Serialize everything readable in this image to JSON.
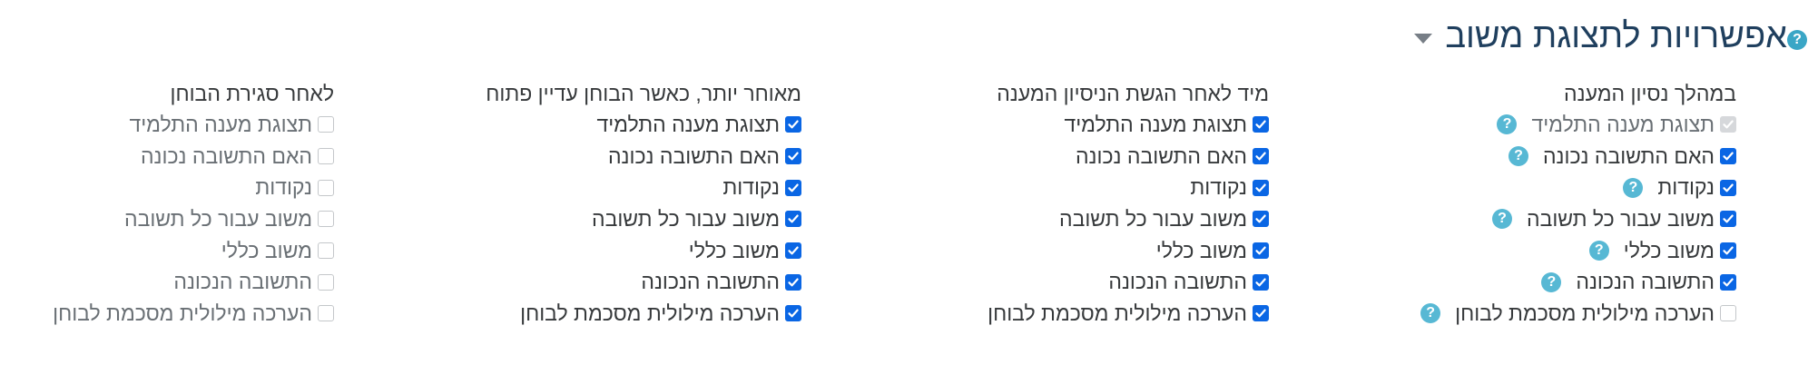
{
  "section": {
    "title": "אפשרויות לתצוגת משוב",
    "help_icon": "question-circle-icon",
    "caret_icon": "caret-down-icon"
  },
  "columns": [
    {
      "heading": "במהלך נסיון המענה",
      "options": [
        {
          "label": "תצוגת מענה התלמיד",
          "state": "checked-disabled",
          "help": true
        },
        {
          "label": "האם התשובה נכונה",
          "state": "checked",
          "help": true
        },
        {
          "label": "נקודות",
          "state": "checked",
          "help": true
        },
        {
          "label": "משוב עבור כל תשובה",
          "state": "checked",
          "help": true
        },
        {
          "label": "משוב כללי",
          "state": "checked",
          "help": true
        },
        {
          "label": "התשובה הנכונה",
          "state": "checked",
          "help": true
        },
        {
          "label": "הערכה מילולית מסכמת לבוחן",
          "state": "unchecked",
          "help": true
        }
      ]
    },
    {
      "heading": "מיד לאחר הגשת הניסיון המענה",
      "options": [
        {
          "label": "תצוגת מענה התלמיד",
          "state": "checked"
        },
        {
          "label": "האם התשובה נכונה",
          "state": "checked"
        },
        {
          "label": "נקודות",
          "state": "checked"
        },
        {
          "label": "משוב עבור כל תשובה",
          "state": "checked"
        },
        {
          "label": "משוב כללי",
          "state": "checked"
        },
        {
          "label": "התשובה הנכונה",
          "state": "checked"
        },
        {
          "label": "הערכה מילולית מסכמת לבוחן",
          "state": "checked"
        }
      ]
    },
    {
      "heading": "מאוחר יותר, כאשר הבוחן עדיין פתוח",
      "options": [
        {
          "label": "תצוגת מענה התלמיד",
          "state": "checked"
        },
        {
          "label": "האם התשובה נכונה",
          "state": "checked"
        },
        {
          "label": "נקודות",
          "state": "checked"
        },
        {
          "label": "משוב עבור כל תשובה",
          "state": "checked"
        },
        {
          "label": "משוב כללי",
          "state": "checked"
        },
        {
          "label": "התשובה הנכונה",
          "state": "checked"
        },
        {
          "label": "הערכה מילולית מסכמת לבוחן",
          "state": "checked"
        }
      ]
    },
    {
      "heading": "לאחר סגירת הבוחן",
      "options": [
        {
          "label": "תצוגת מענה התלמיד",
          "state": "unchecked-disabled"
        },
        {
          "label": "האם התשובה נכונה",
          "state": "unchecked-disabled"
        },
        {
          "label": "נקודות",
          "state": "unchecked-disabled"
        },
        {
          "label": "משוב עבור כל תשובה",
          "state": "unchecked-disabled"
        },
        {
          "label": "משוב כללי",
          "state": "unchecked-disabled"
        },
        {
          "label": "התשובה הנכונה",
          "state": "unchecked-disabled"
        },
        {
          "label": "הערכה מילולית מסכמת לבוחן",
          "state": "unchecked-disabled"
        }
      ]
    }
  ],
  "colors": {
    "title": "#1f3f5e",
    "checkbox_checked": "#0a66e4",
    "help_icon": "#3aa6c6"
  }
}
